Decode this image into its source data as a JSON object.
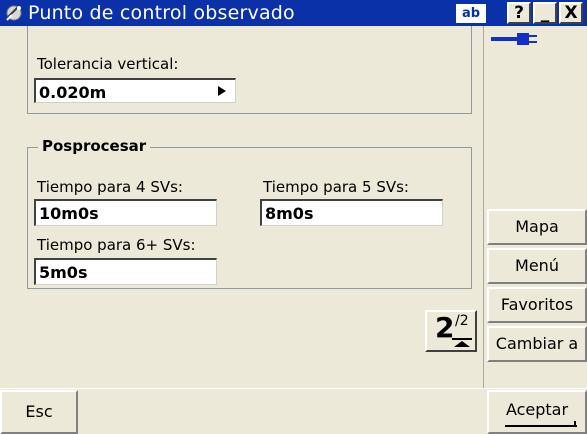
{
  "window": {
    "title": "Punto de control observado",
    "input_mode_badge": "ab",
    "help_label": "?",
    "minimize_label": "_",
    "close_label": "X"
  },
  "upper_section": {
    "vertical_tolerance_label": "Tolerancia vertical:",
    "vertical_tolerance_value": "0.020m"
  },
  "postprocess": {
    "group_title": "Posprocesar",
    "time_4sv_label": "Tiempo para  4 SVs:",
    "time_4sv_value": "10m0s",
    "time_5sv_label": "Tiempo para 5 SVs:",
    "time_5sv_value": "8m0s",
    "time_6sv_label": "Tiempo para 6+ SVs:",
    "time_6sv_value": "5m0s"
  },
  "pager": {
    "current_page": "2",
    "total_pages": "/2"
  },
  "side_buttons": {
    "map": "Mapa",
    "menu": "Menú",
    "favorites": "Favoritos",
    "switch_to": "Cambiar a"
  },
  "bottom_bar": {
    "esc": "Esc",
    "accept": "Aceptar"
  },
  "icons": {
    "title_icon": "satellite-dish-icon",
    "status_icon": "power-plug-icon",
    "pager_arrow": "up-triangle-icon",
    "field_arrow": "right-triangle-icon"
  },
  "colors": {
    "titlebar": "#0a31a8",
    "background": "#ece9d8",
    "status_plug": "#1030c8"
  }
}
